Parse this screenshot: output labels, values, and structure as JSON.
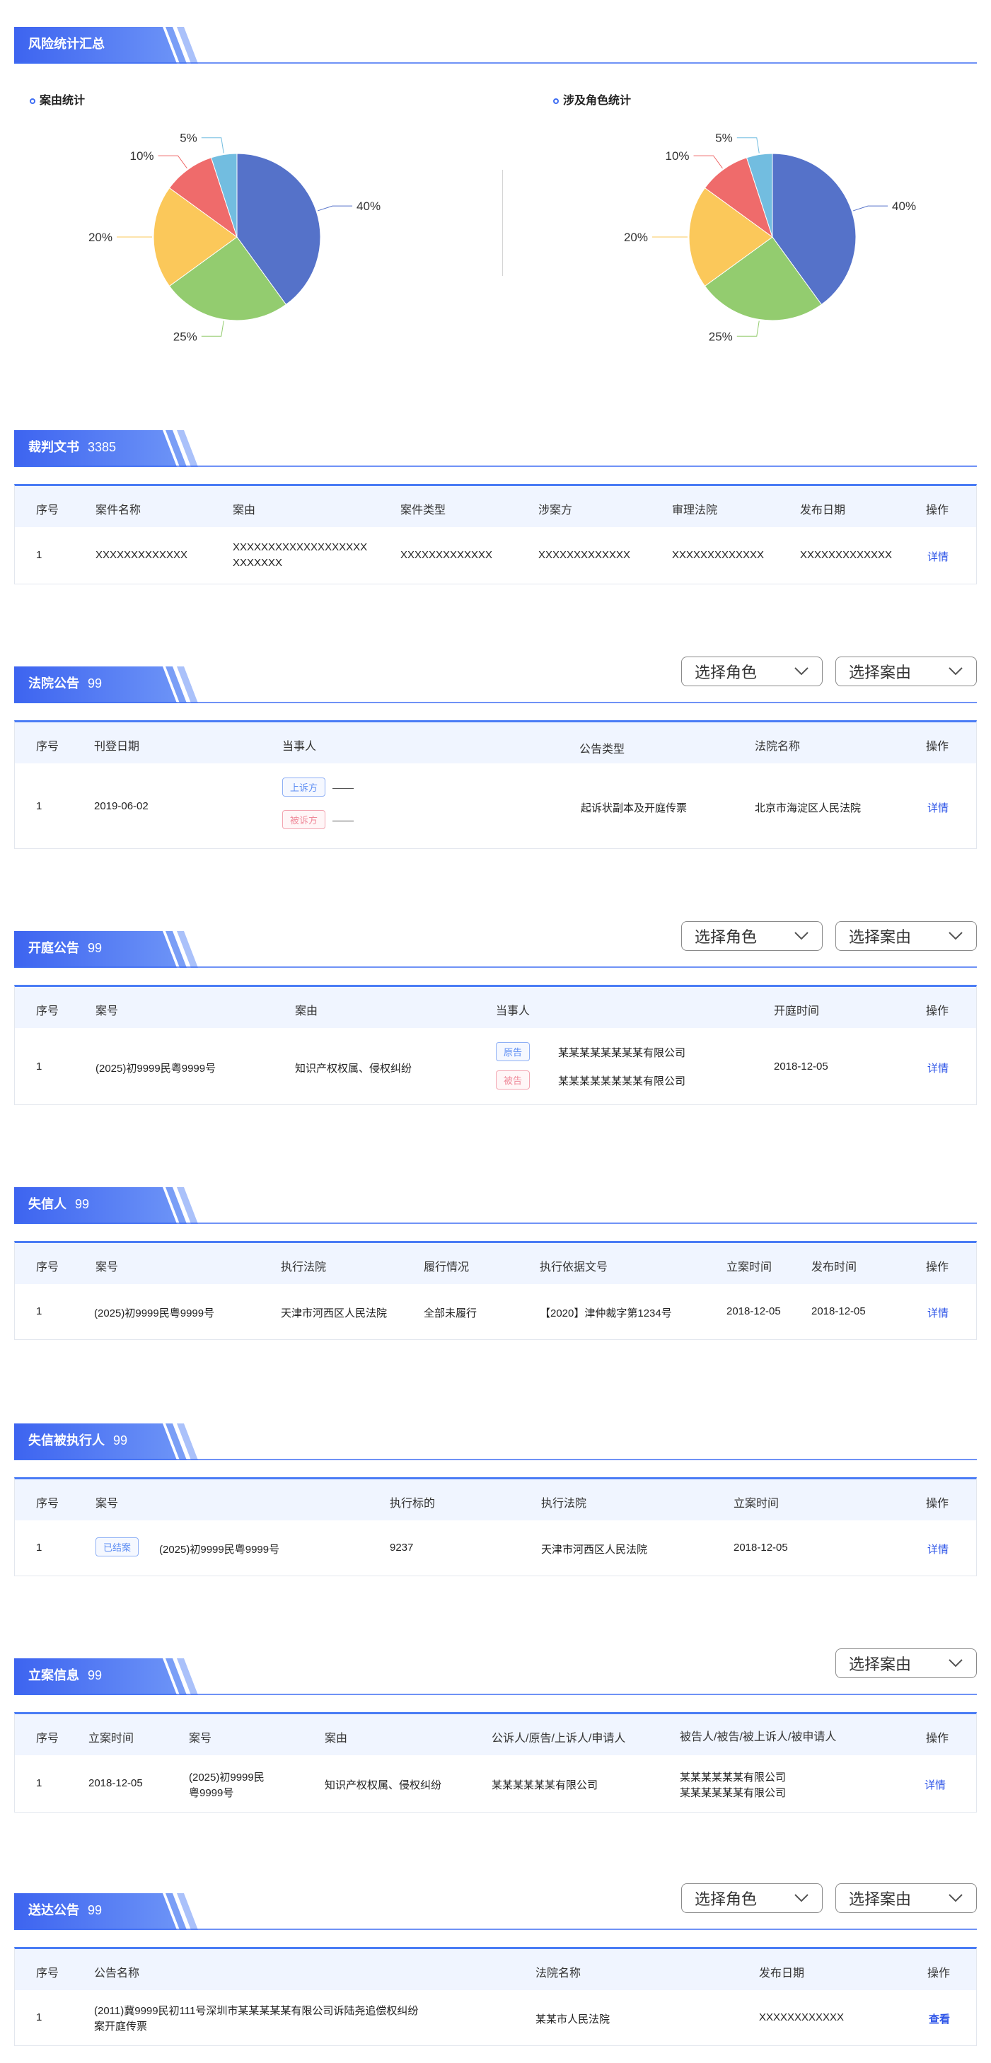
{
  "colors": {
    "accent": "#3f6ef3",
    "link": "#2f56e8",
    "pie": [
      "#5572c9",
      "#93cc6f",
      "#fbc85a",
      "#ef6b6b",
      "#72bde0"
    ]
  },
  "risk": {
    "title": "风险统计汇总",
    "charts": [
      {
        "title": "案由统计",
        "slices": [
          {
            "label": "40%",
            "value": 40
          },
          {
            "label": "25%",
            "value": 25
          },
          {
            "label": "20%",
            "value": 20
          },
          {
            "label": "10%",
            "value": 10
          },
          {
            "label": "5%",
            "value": 5
          }
        ]
      },
      {
        "title": "涉及角色统计",
        "slices": [
          {
            "label": "40%",
            "value": 40
          },
          {
            "label": "25%",
            "value": 25
          },
          {
            "label": "20%",
            "value": 20
          },
          {
            "label": "10%",
            "value": 10
          },
          {
            "label": "5%",
            "value": 5
          }
        ]
      }
    ]
  },
  "chart_data": [
    {
      "type": "pie",
      "title": "案由统计",
      "values": [
        40,
        25,
        20,
        10,
        5
      ],
      "labels": [
        "40%",
        "25%",
        "20%",
        "10%",
        "5%"
      ]
    },
    {
      "type": "pie",
      "title": "涉及角色统计",
      "values": [
        40,
        25,
        20,
        10,
        5
      ],
      "labels": [
        "40%",
        "25%",
        "20%",
        "10%",
        "5%"
      ]
    }
  ],
  "selects": {
    "role": "选择角色",
    "cause": "选择案由"
  },
  "judgments": {
    "title": "裁判文书",
    "count": "3385",
    "headers": [
      "序号",
      "案件名称",
      "案由",
      "案件类型",
      "涉案方",
      "审理法院",
      "发布日期",
      "操作"
    ],
    "row": {
      "no": "1",
      "name": "XXXXXXXXXXXXX",
      "cause1": "XXXXXXXXXXXXXXXXXXX",
      "cause2": "XXXXXXX",
      "type": "XXXXXXXXXXXXX",
      "party": "XXXXXXXXXXXXX",
      "court": "XXXXXXXXXXXXX",
      "date": "XXXXXXXXXXXXX",
      "action": "详情"
    }
  },
  "court_notice": {
    "title": "法院公告",
    "count": "99",
    "headers": [
      "序号",
      "刊登日期",
      "当事人",
      "公告类型",
      "法院名称",
      "操作"
    ],
    "row": {
      "no": "1",
      "date": "2019-06-02",
      "tag1": "上诉方",
      "tag2": "被诉方",
      "type": "起诉状副本及开庭传票",
      "court": "北京市海淀区人民法院",
      "action": "详情"
    }
  },
  "hearing": {
    "title": "开庭公告",
    "count": "99",
    "headers": [
      "序号",
      "案号",
      "案由",
      "当事人",
      "开庭时间",
      "操作"
    ],
    "row": {
      "no": "1",
      "case": "(2025)初9999民粤9999号",
      "cause": "知识产权权属、侵权纠纷",
      "tag1": "原告",
      "party1": "某某某某某某某某有限公司",
      "tag2": "被告",
      "party2": "某某某某某某某某有限公司",
      "time": "2018-12-05",
      "action": "详情"
    }
  },
  "dishonest": {
    "title": "失信人",
    "count": "99",
    "headers": [
      "序号",
      "案号",
      "执行法院",
      "履行情况",
      "执行依据文号",
      "立案时间",
      "发布时间",
      "操作"
    ],
    "row": {
      "no": "1",
      "case": "(2025)初9999民粤9999号",
      "court": "天津市河西区人民法院",
      "status": "全部未履行",
      "basis": "【2020】津仲裁字第1234号",
      "filed": "2018-12-05",
      "published": "2018-12-05",
      "action": "详情"
    }
  },
  "executed": {
    "title": "失信被执行人",
    "count": "99",
    "headers": [
      "序号",
      "案号",
      "执行标的",
      "执行法院",
      "立案时间",
      "操作"
    ],
    "row": {
      "no": "1",
      "tag": "已结案",
      "case": "(2025)初9999民粤9999号",
      "amount": "9237",
      "court": "天津市河西区人民法院",
      "filed": "2018-12-05",
      "action": "详情"
    }
  },
  "filing": {
    "title": "立案信息",
    "count": "99",
    "headers": [
      "序号",
      "立案时间",
      "案号",
      "案由",
      "公诉人/原告/上诉人/申请人",
      "被告人/被告/被上诉人/被申请人",
      "操作"
    ],
    "row": {
      "no": "1",
      "filed": "2018-12-05",
      "case1": "(2025)初9999民",
      "case2": "粤9999号",
      "cause": "知识产权权属、侵权纠纷",
      "plaintiff": "某某某某某某有限公司",
      "defendant1": "某某某某某某有限公司",
      "defendant2": "某某某某某某有限公司",
      "action": "详情"
    }
  },
  "delivery": {
    "title": "送达公告",
    "count": "99",
    "headers": [
      "序号",
      "公告名称",
      "法院名称",
      "发布日期",
      "操作"
    ],
    "row": {
      "no": "1",
      "name1": "(2011)冀9999民初111号深圳市某某某某某有限公司诉陆尧追偿权纠纷",
      "name2": "案开庭传票",
      "court": "某某市人民法院",
      "date": "XXXXXXXXXXXX",
      "action": "查看"
    }
  }
}
